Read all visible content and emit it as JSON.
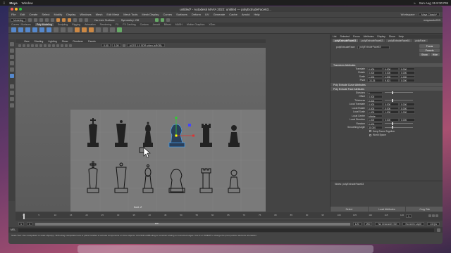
{
  "mac_menubar": {
    "app": "Maya",
    "window_menu": "Window",
    "clock": "Sun Aug 15  8:30 PM"
  },
  "window": {
    "title": "untitled* - Autodesk MAYA 2022: untitled  ---  polyExtrudeFace63..."
  },
  "main_menu": [
    "File",
    "Edit",
    "Create",
    "Select",
    "Modify",
    "Display",
    "Windows",
    "Mesh",
    "Edit Mesh",
    "Mesh Tools",
    "Mesh Display",
    "Curves",
    "Surfaces",
    "Deform",
    "UV",
    "Generate",
    "Cache",
    "Arnold",
    "Help"
  ],
  "workspace": {
    "label": "Workspace :",
    "value": "Maya Classic*"
  },
  "status_line": {
    "mode": "Modeling",
    "no_live": "No Live Surface",
    "symmetry": "Symmetry: Off",
    "user": "mayaocto203"
  },
  "shelf_tabs": [
    "Curves / Surfaces",
    "Poly Modeling",
    "Sculpting",
    "Rigging",
    "Animation",
    "Rendering",
    "FX",
    "FX Caching",
    "Custom",
    "Arnold",
    "Bifrost",
    "MASH",
    "Motion Graphics",
    "XGen"
  ],
  "shelf_active": "Poly Modeling",
  "viewport": {
    "menus": [
      "View",
      "Shading",
      "Lighting",
      "Show",
      "Renderer",
      "Panels"
    ],
    "near": "0.00",
    "far": "1.00",
    "color_space": "ACES 1.0 SDR-video (sRGB)",
    "camera_label": "front -Z"
  },
  "channel_box": {
    "tabs": [
      "List",
      "Selected",
      "Focus",
      "Attributes",
      "Display",
      "Show",
      "Help"
    ],
    "node_tabs": [
      "polyExtrudeFace63",
      "polyExtrudeFace62",
      "polyExtrudeFace61",
      "polyFace"
    ],
    "node_label": "polyExtrudeFace:",
    "node_value": "polyExtrudeFace63",
    "buttons": {
      "focus": "Focus",
      "presets": "Presets",
      "show": "Show",
      "hide": "Hide"
    },
    "transform_section": "Transform Attributes",
    "transform_rows": [
      {
        "label": "Translate",
        "v": [
          "0.000",
          "0.000",
          "0.000"
        ]
      },
      {
        "label": "Rotate",
        "v": [
          "0.000",
          "0.000",
          "0.000"
        ]
      },
      {
        "label": "Scale",
        "v": [
          "1.000",
          "1.000",
          "1.000"
        ]
      },
      {
        "label": "Pivot",
        "v": [
          "-3.125",
          "9.821",
          "0.000"
        ]
      }
    ],
    "curve_section": "Poly Extrude Curve Attributes",
    "face_section": "Poly Extrude Face Attributes",
    "face_rows": [
      {
        "label": "Divisions",
        "v": "1",
        "slider": true
      },
      {
        "label": "Offset",
        "v": "0.000",
        "slider": false
      },
      {
        "label": "Thickness",
        "v": "0.000",
        "slider": true
      },
      {
        "label": "Local Translate",
        "v": "0.000",
        "extra": [
          "0.000",
          "0.000"
        ]
      },
      {
        "label": "Local Rotate",
        "v": "0.000",
        "extra": [
          "0.000",
          "0.000"
        ]
      },
      {
        "label": "Local Scale",
        "v": "1.000",
        "extra": [
          "1.000",
          "1.000"
        ]
      },
      {
        "label": "Local Center",
        "v": "Middle",
        "slider": false
      },
      {
        "label": "Local Direction",
        "v": "1.000",
        "extra": [
          "0.000",
          "0.000"
        ]
      },
      {
        "label": "Random",
        "v": "0.000",
        "slider": true
      },
      {
        "label": "Smoothing Angle",
        "v": "30.000",
        "slider": true
      }
    ],
    "checks": [
      "Keep Faces Together",
      "World Space"
    ],
    "notes_label": "Notes:  polyExtrudeFace63",
    "bottom_buttons": [
      "Select",
      "Load Attributes",
      "Copy Tab"
    ]
  },
  "timeline": {
    "ticks": [
      "1",
      "5",
      "10",
      "15",
      "20",
      "25",
      "30",
      "35",
      "40",
      "45",
      "50",
      "55",
      "60",
      "65",
      "70",
      "75",
      "80",
      "85",
      "90",
      "95",
      "100",
      "105",
      "110",
      "115",
      "120"
    ],
    "current": "1"
  },
  "range": {
    "start": "1",
    "start2": "1",
    "end": "120",
    "end2": "120",
    "end3": "200",
    "no_char": "No Character Set",
    "no_anim": "No Anim Layer",
    "fps": "24 fps"
  },
  "command": {
    "lang": "MEL"
  },
  "help_line": "Scale Tool: Use manipulator to scale object(s). Shift+drag manipulator axis or plane handles to extrude components or clone objects. Ctrl+Shift+LMB+drag to constrain scaling to connected edges. Use D or INSERT to change the pivot position and axis orientation."
}
